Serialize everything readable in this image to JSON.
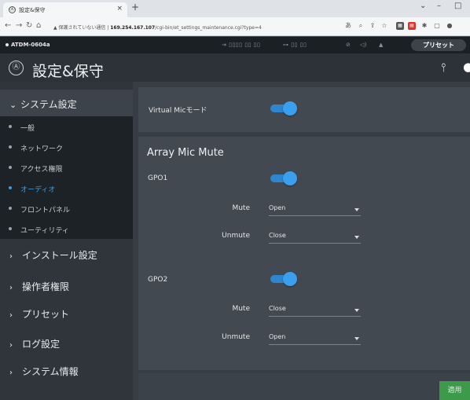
{
  "browser": {
    "tab_title": "設定&保守",
    "tab_close": "×",
    "new_tab": "+",
    "window_controls": {
      "minimize": "–",
      "maximize": "□",
      "chevron": "⌄"
    },
    "url": {
      "security_warning": "保護されていない通信",
      "host": "169.254.167.107",
      "path": "/cgi-bin/et_settings_maintenance.cgi?type=4"
    }
  },
  "device": {
    "name": "ATDM-0604a",
    "status_items": [
      "⇥ ▯▯▯▯ ▯▯ ▯▯",
      "⊶ ▯▯ ▯▯"
    ],
    "preset_button": "プリセット"
  },
  "header": {
    "logo_glyph": "Ⓐ",
    "title": "設定&保守",
    "mixer_glyph": "⫯",
    "user_glyph": "👤"
  },
  "sidebar": {
    "open_section": {
      "label": "システム設定",
      "chevron": "⌄"
    },
    "sub_items": [
      {
        "label": "一般",
        "active": false
      },
      {
        "label": "ネットワーク",
        "active": false
      },
      {
        "label": "アクセス権限",
        "active": false
      },
      {
        "label": "オーディオ",
        "active": true
      },
      {
        "label": "フロントパネル",
        "active": false
      },
      {
        "label": "ユーティリティ",
        "active": false
      }
    ],
    "sections": [
      {
        "label": "インストール設定",
        "chevron": "›"
      },
      {
        "label": "操作者権限",
        "chevron": "›"
      },
      {
        "label": "プリセット",
        "chevron": "›"
      },
      {
        "label": "ログ設定",
        "chevron": "›"
      },
      {
        "label": "システム情報",
        "chevron": "›"
      }
    ]
  },
  "main": {
    "virtual_mic": {
      "label": "Virtual Micモード",
      "enabled": true
    },
    "array_mic_mute": {
      "title": "Array Mic Mute",
      "gpo1": {
        "label": "GPO1",
        "enabled": true,
        "mute_label": "Mute",
        "mute_value": "Open",
        "unmute_label": "Unmute",
        "unmute_value": "Close"
      },
      "gpo2": {
        "label": "GPO2",
        "enabled": true,
        "mute_label": "Mute",
        "mute_value": "Close",
        "unmute_label": "Unmute",
        "unmute_value": "Open"
      }
    },
    "apply_button": "適用"
  },
  "colors": {
    "accent": "#3aa0ee",
    "apply": "#3c9a4a",
    "sidebar_bg": "#2f353b",
    "content_bg": "#363d44",
    "card_bg": "#424951"
  }
}
